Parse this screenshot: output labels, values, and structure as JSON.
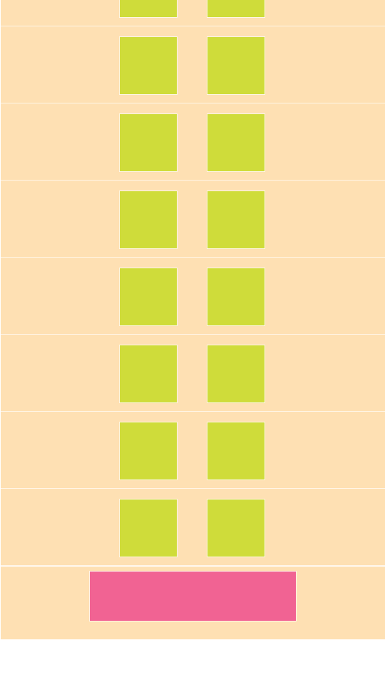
{
  "colors": {
    "background": "#fee0b3",
    "tile": "#cfdc3a",
    "button": "#f16393",
    "divider": "#fff6e8"
  },
  "list": {
    "rows": [
      {
        "tiles": [
          "tile",
          "tile"
        ]
      },
      {
        "tiles": [
          "tile",
          "tile"
        ]
      },
      {
        "tiles": [
          "tile",
          "tile"
        ]
      },
      {
        "tiles": [
          "tile",
          "tile"
        ]
      },
      {
        "tiles": [
          "tile",
          "tile"
        ]
      },
      {
        "tiles": [
          "tile",
          "tile"
        ]
      },
      {
        "tiles": [
          "tile",
          "tile"
        ]
      },
      {
        "tiles": [
          "tile",
          "tile"
        ]
      }
    ]
  },
  "footer": {
    "button_label": ""
  }
}
